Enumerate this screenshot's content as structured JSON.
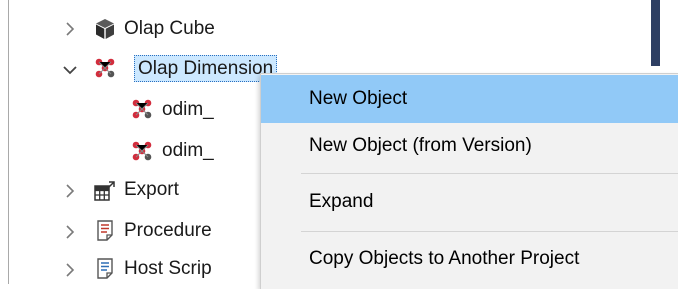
{
  "tree": {
    "olap_cube": "Olap Cube",
    "olap_dimension": "Olap Dimension",
    "child_1": "odim_",
    "child_2": "odim_",
    "export": "Export",
    "procedure": "Procedure",
    "host_script": "Host Scrip"
  },
  "context_menu": {
    "items": [
      "New Object",
      "New Object (from Version)",
      "Expand",
      "Copy Objects to Another Project"
    ],
    "highlighted_index": 0
  },
  "colors": {
    "menu_highlight": "#91c9f7",
    "selection": "#cce8ff",
    "menu_bg": "#f2f2f2",
    "accent_bar": "#2e3f63"
  },
  "icons": {
    "collapsed": "chevron-right-icon",
    "expanded": "chevron-down-icon",
    "olap_cube": "cube-icon",
    "olap_dimension": "dimension-dots-icon",
    "export": "grid-export-icon",
    "procedure": "document-icon",
    "host_script": "document-icon"
  }
}
